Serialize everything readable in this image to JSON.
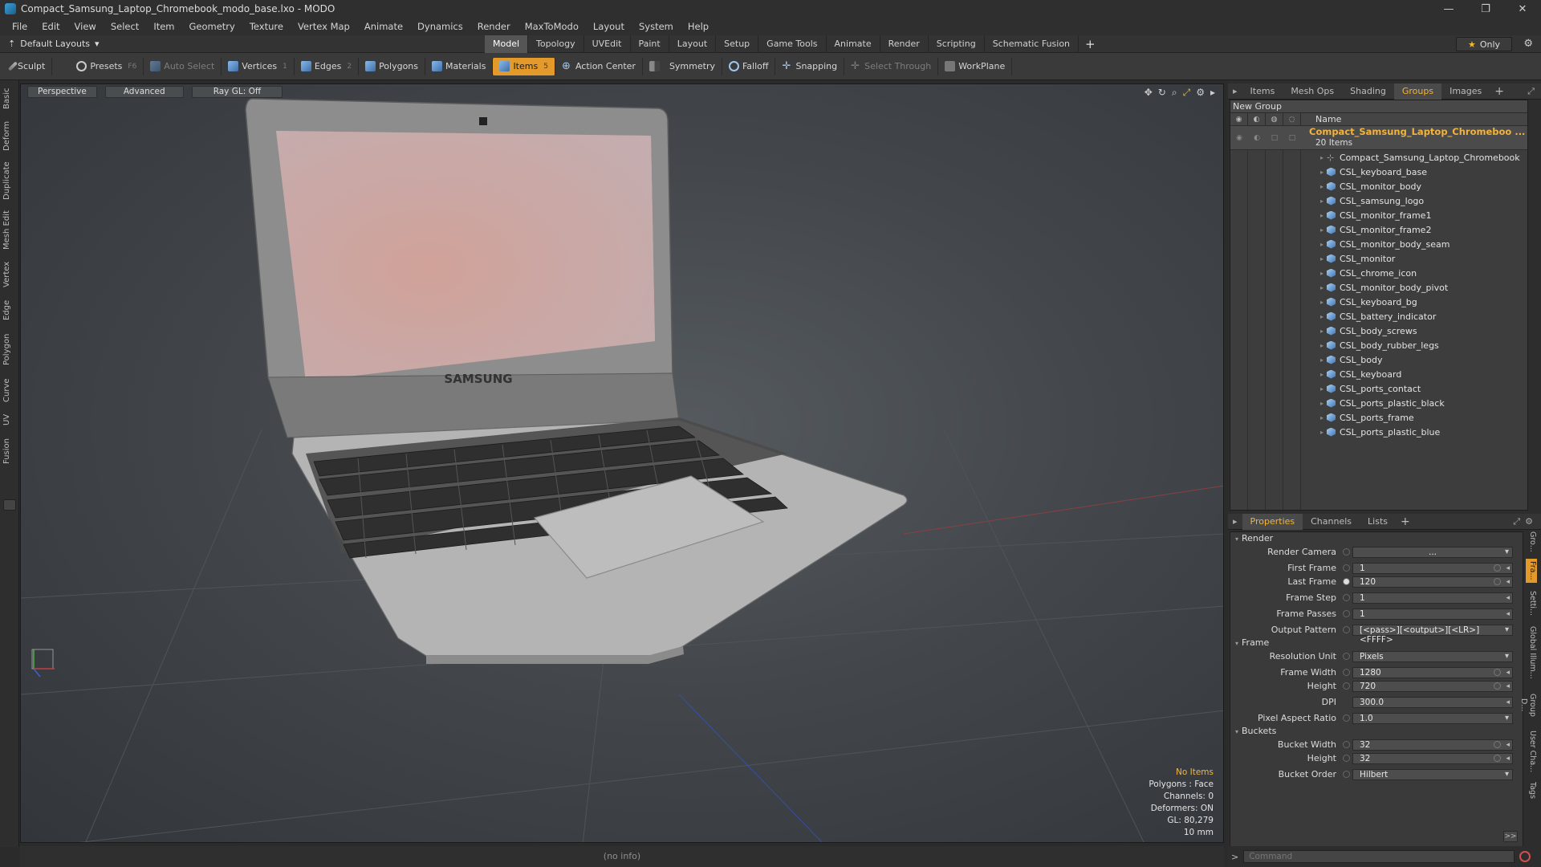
{
  "window": {
    "title": "Compact_Samsung_Laptop_Chromebook_modo_base.lxo - MODO",
    "controls": [
      "—",
      "❐",
      "✕"
    ]
  },
  "menu": [
    "File",
    "Edit",
    "View",
    "Select",
    "Item",
    "Geometry",
    "Texture",
    "Vertex Map",
    "Animate",
    "Dynamics",
    "Render",
    "MaxToModo",
    "Layout",
    "System",
    "Help"
  ],
  "layout_row": {
    "layout_select": "Default Layouts",
    "tabs": [
      "Model",
      "Topology",
      "UVEdit",
      "Paint",
      "Layout",
      "Setup",
      "Game Tools",
      "Animate",
      "Render",
      "Scripting",
      "Schematic Fusion"
    ],
    "active_tab": "Model",
    "only_label": "Only"
  },
  "toolbar": {
    "sculpt": "Sculpt",
    "presets": "Presets",
    "presets_key": "F6",
    "auto_select": "Auto Select",
    "vertices": "Vertices",
    "vertices_key": "1",
    "edges": "Edges",
    "edges_key": "2",
    "polygons": "Polygons",
    "materials": "Materials",
    "items": "Items",
    "items_key": "5",
    "action_center": "Action Center",
    "symmetry": "Symmetry",
    "falloff": "Falloff",
    "snapping": "Snapping",
    "select_through": "Select Through",
    "workplane": "WorkPlane"
  },
  "left_tabs": [
    "Basic",
    "Deform",
    "Duplicate",
    "Mesh Edit",
    "Vertex",
    "Edge",
    "Polygon",
    "Curve",
    "UV",
    "Fusion"
  ],
  "viewport": {
    "view": "Perspective",
    "mode": "Advanced",
    "raygl": "Ray GL: Off",
    "screen_logo": "SAMSUNG",
    "info": {
      "selection": "No Items",
      "polygons": "Polygons : Face",
      "channels": "Channels: 0",
      "deformers": "Deformers: ON",
      "gl": "GL: 80,279",
      "units": "10 mm"
    }
  },
  "status": "(no info)",
  "groups_panel": {
    "tabs": [
      "Items",
      "Mesh Ops",
      "Shading",
      "Groups",
      "Images"
    ],
    "active_tab": "Groups",
    "new_group": "New Group",
    "column_name": "Name",
    "group_name": "Compact_Samsung_Laptop_Chromeboo ...",
    "group_count": "20 Items",
    "items": [
      "Compact_Samsung_Laptop_Chromebook",
      "CSL_keyboard_base",
      "CSL_monitor_body",
      "CSL_samsung_logo",
      "CSL_monitor_frame1",
      "CSL_monitor_frame2",
      "CSL_monitor_body_seam",
      "CSL_monitor",
      "CSL_chrome_icon",
      "CSL_monitor_body_pivot",
      "CSL_keyboard_bg",
      "CSL_battery_indicator",
      "CSL_body_screws",
      "CSL_body_rubber_legs",
      "CSL_body",
      "CSL_keyboard",
      "CSL_ports_contact",
      "CSL_ports_plastic_black",
      "CSL_ports_frame",
      "CSL_ports_plastic_blue"
    ]
  },
  "properties_panel": {
    "tabs": [
      "Properties",
      "Channels",
      "Lists"
    ],
    "active_tab": "Properties",
    "render_section": "Render",
    "render_camera_label": "Render Camera",
    "render_camera_value": "...",
    "first_frame_label": "First Frame",
    "first_frame": "1",
    "last_frame_label": "Last Frame",
    "last_frame": "120",
    "frame_step_label": "Frame Step",
    "frame_step": "1",
    "frame_passes_label": "Frame Passes",
    "frame_passes": "1",
    "output_pattern_label": "Output Pattern",
    "output_pattern": "[<pass>][<output>][<LR>] <FFFF>",
    "frame_section": "Frame",
    "resolution_unit_label": "Resolution Unit",
    "resolution_unit": "Pixels",
    "frame_width_label": "Frame Width",
    "frame_width": "1280",
    "height_label": "Height",
    "frame_height": "720",
    "dpi_label": "DPI",
    "dpi": "300.0",
    "pixel_aspect_label": "Pixel Aspect Ratio",
    "pixel_aspect": "1.0",
    "buckets_section": "Buckets",
    "bucket_width_label": "Bucket Width",
    "bucket_width": "32",
    "bucket_height_label": "Height",
    "bucket_height": "32",
    "bucket_order_label": "Bucket Order",
    "bucket_order": "Hilbert",
    "more": ">>"
  },
  "right_edge_tabs": [
    "Gro...",
    "Fra...",
    "Setti...",
    "Global Illum...",
    "Group D...",
    "User Cha...",
    "Tags"
  ],
  "command": {
    "prompt": ">",
    "placeholder": "Command"
  }
}
